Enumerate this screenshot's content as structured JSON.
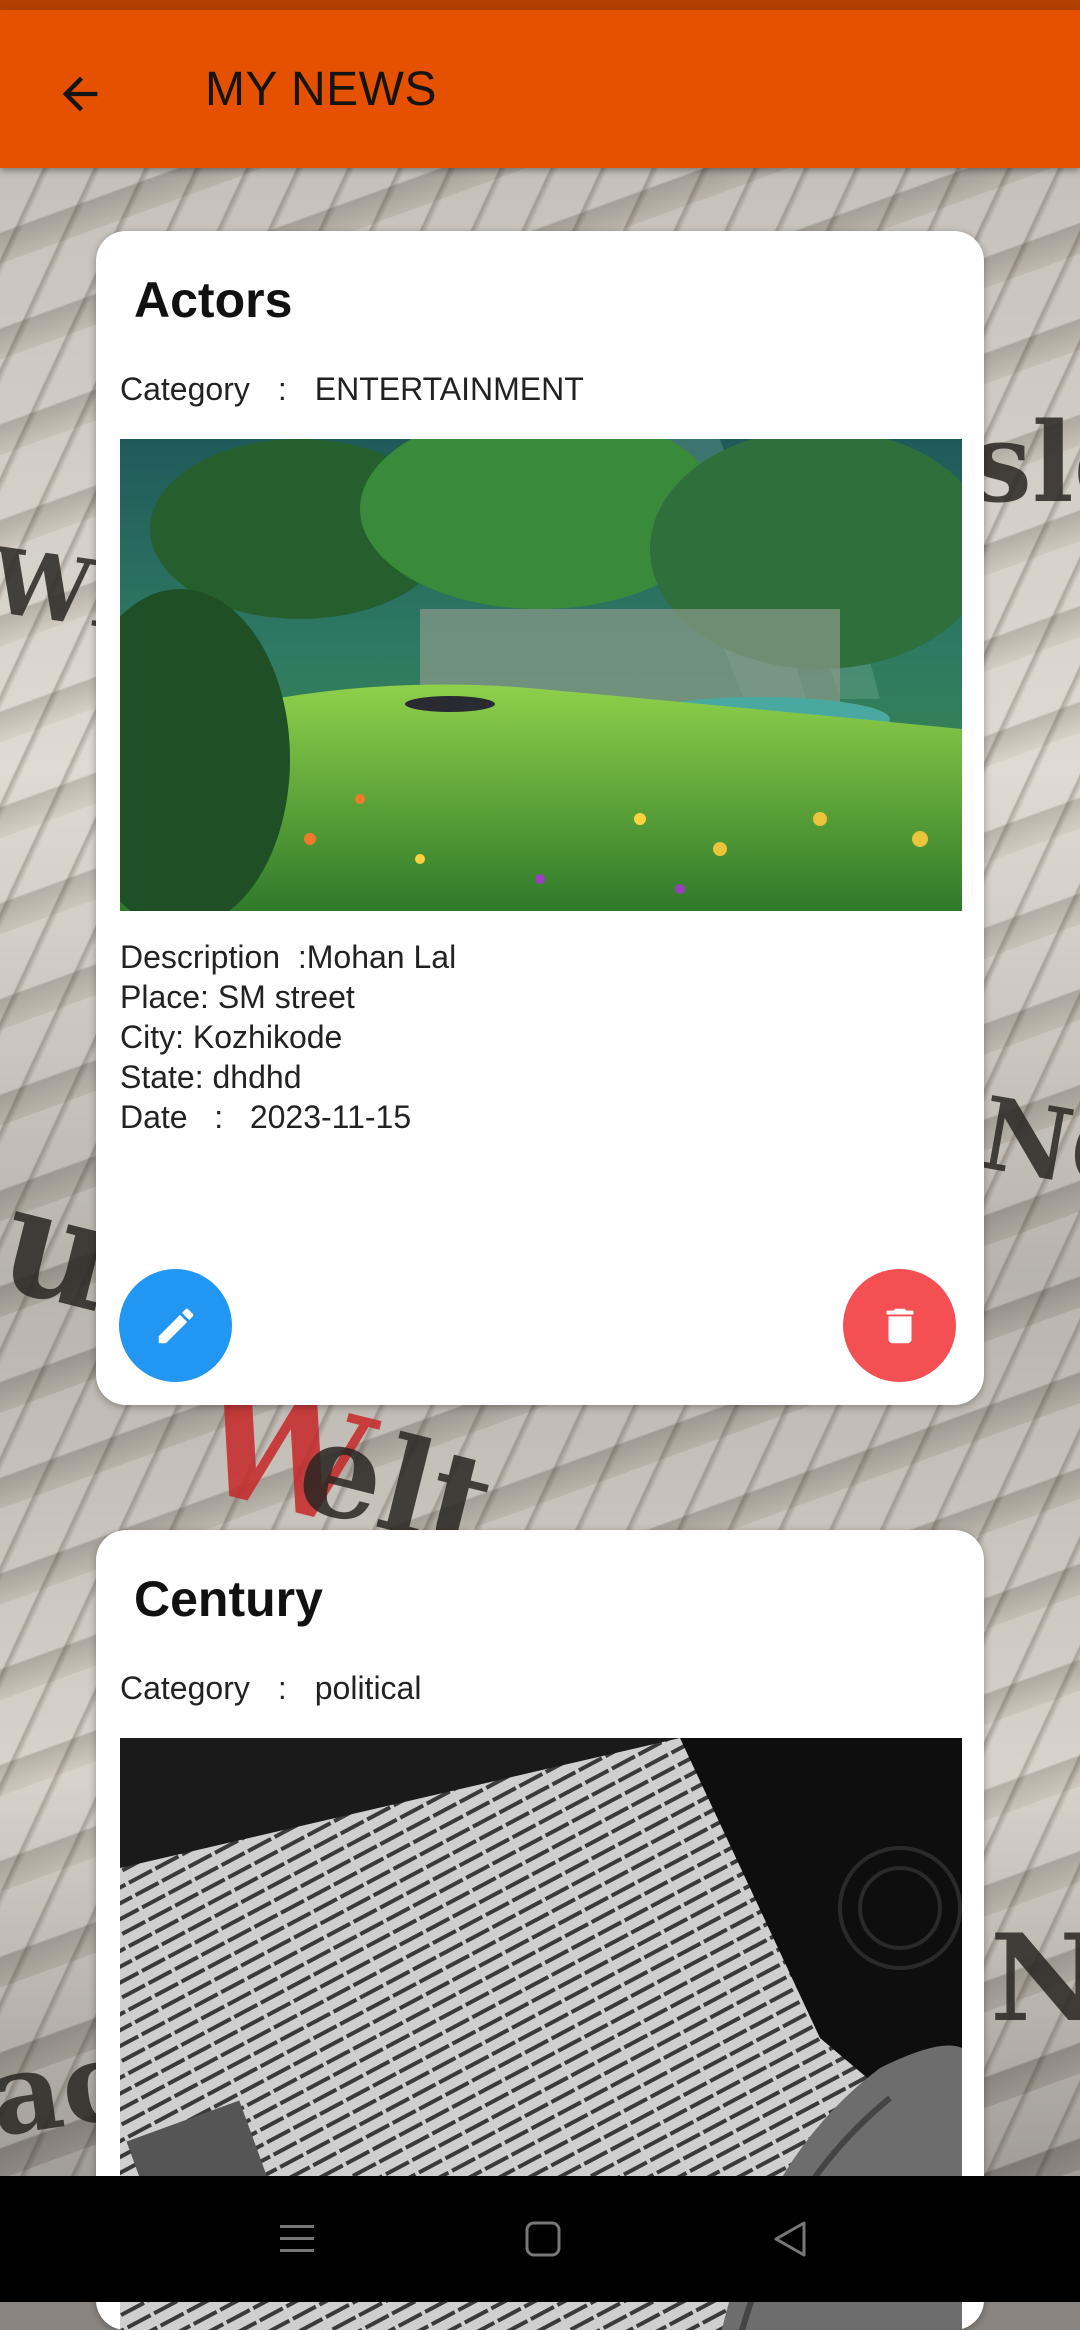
{
  "app": {
    "title": "MY NEWS",
    "accent_color": "#e65100",
    "back_icon": "arrow-left-icon"
  },
  "news": [
    {
      "title": "Actors",
      "category_label": "Category",
      "category_sep": ":",
      "category": "ENTERTAINMENT",
      "image_desc_icon": "meadow-landscape-image",
      "description": "Description  :Mohan Lal",
      "place": "Place: SM street",
      "city": "City: Kozhikode",
      "state": "State: dhdhd",
      "date_label": "Date   :   2023-11-15",
      "edit_icon": "pencil-icon",
      "delete_icon": "trash-icon"
    },
    {
      "title": "Century",
      "category_label": "Category",
      "category_sep": ":",
      "category": "political",
      "image_desc_icon": "newspaper-image"
    }
  ],
  "navbar": {
    "recent_icon": "recent-apps-icon",
    "home_icon": "home-icon",
    "back_icon": "nav-back-icon"
  }
}
